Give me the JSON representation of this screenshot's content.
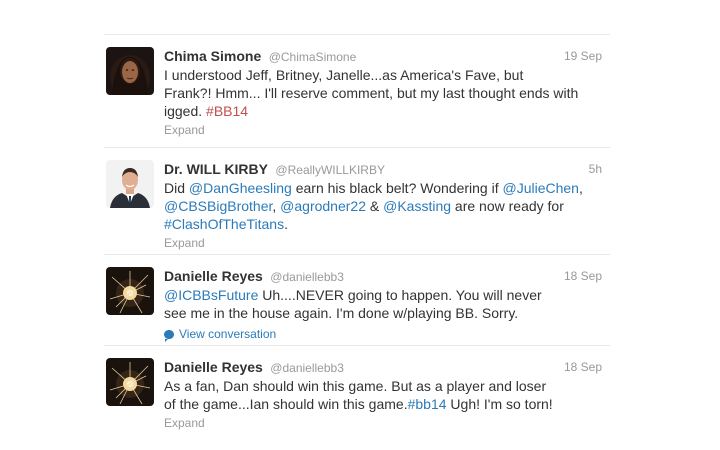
{
  "tweets": [
    {
      "fullname": "Chima Simone",
      "username": "@ChimaSimone",
      "time": "19 Sep",
      "text_parts": [
        "I understood Jeff, Britney, Janelle...as America's Fave, but",
        "Frank?! Hmm... I'll reserve comment, but my last thought ends with",
        "igged. ",
        "#BB14"
      ],
      "action": "Expand"
    },
    {
      "fullname": "Dr. WILL KIRBY",
      "username": "@ReallyWILLKIRBY",
      "time": "5h",
      "text_parts": [
        "Did ",
        "@DanGheesling",
        " earn his black belt? Wondering if ",
        "@JulieChen",
        ",",
        "@CBSBigBrother",
        ", ",
        "@agrodner22",
        " & ",
        "@Kassting",
        " are now ready for",
        "#ClashOfTheTitans",
        "."
      ],
      "action": "Expand"
    },
    {
      "fullname": "Danielle Reyes",
      "username": "@daniellebb3",
      "time": "18 Sep",
      "text_parts": [
        "@ICBBsFuture",
        " Uh....NEVER going to happen. You will never",
        "see me in the house again. I'm done w/playing BB. Sorry."
      ],
      "action": "View conversation"
    },
    {
      "fullname": "Danielle Reyes",
      "username": "@daniellebb3",
      "time": "18 Sep",
      "text_parts": [
        "As a fan, Dan should win this game. But as a player and loser",
        "of the game...Ian should win this game.",
        "#bb14",
        " Ugh! I'm so torn!"
      ],
      "action": "Expand"
    }
  ],
  "colors": {
    "link": "#2b7bb9",
    "hashtag_first": "#c0504d",
    "muted": "#999999"
  }
}
